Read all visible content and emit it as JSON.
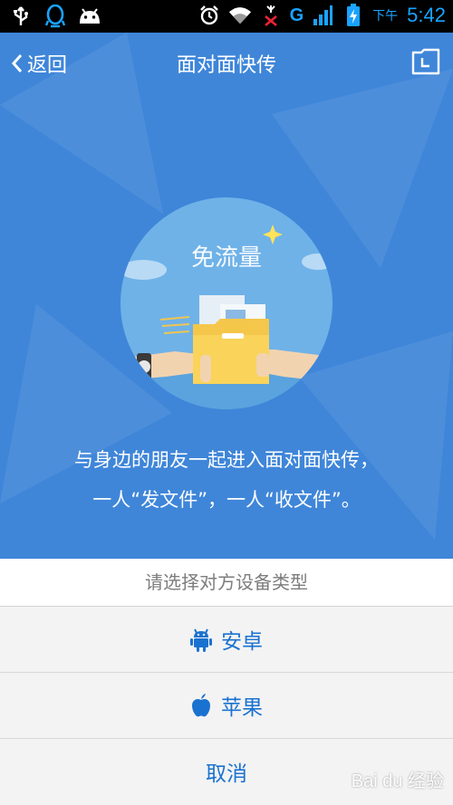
{
  "status_bar": {
    "ampm": "下午",
    "time": "5:42",
    "network": "G",
    "icons": [
      "usb-icon",
      "qq-icon",
      "android-icon",
      "alarm-icon",
      "wifi-icon",
      "no-sim-icon",
      "signal-icon",
      "battery-charging-icon"
    ]
  },
  "nav": {
    "back_label": "返回",
    "title": "面对面快传",
    "folder_icon": "folder-icon"
  },
  "illustration": {
    "label": "免流量"
  },
  "description": {
    "line1": "与身边的朋友一起进入面对面快传，",
    "line2": "一人“发文件”，一人“收文件”。"
  },
  "sheet": {
    "header": "请选择对方设备类型",
    "options": [
      {
        "label": "安卓",
        "icon": "android-icon"
      },
      {
        "label": "苹果",
        "icon": "apple-icon"
      },
      {
        "label": "取消"
      }
    ]
  },
  "watermark": "Bai du 经验",
  "colors": {
    "primary_blue": "#3f86d9",
    "option_text": "#1a72d0",
    "status_accent": "#1aa3ff"
  }
}
